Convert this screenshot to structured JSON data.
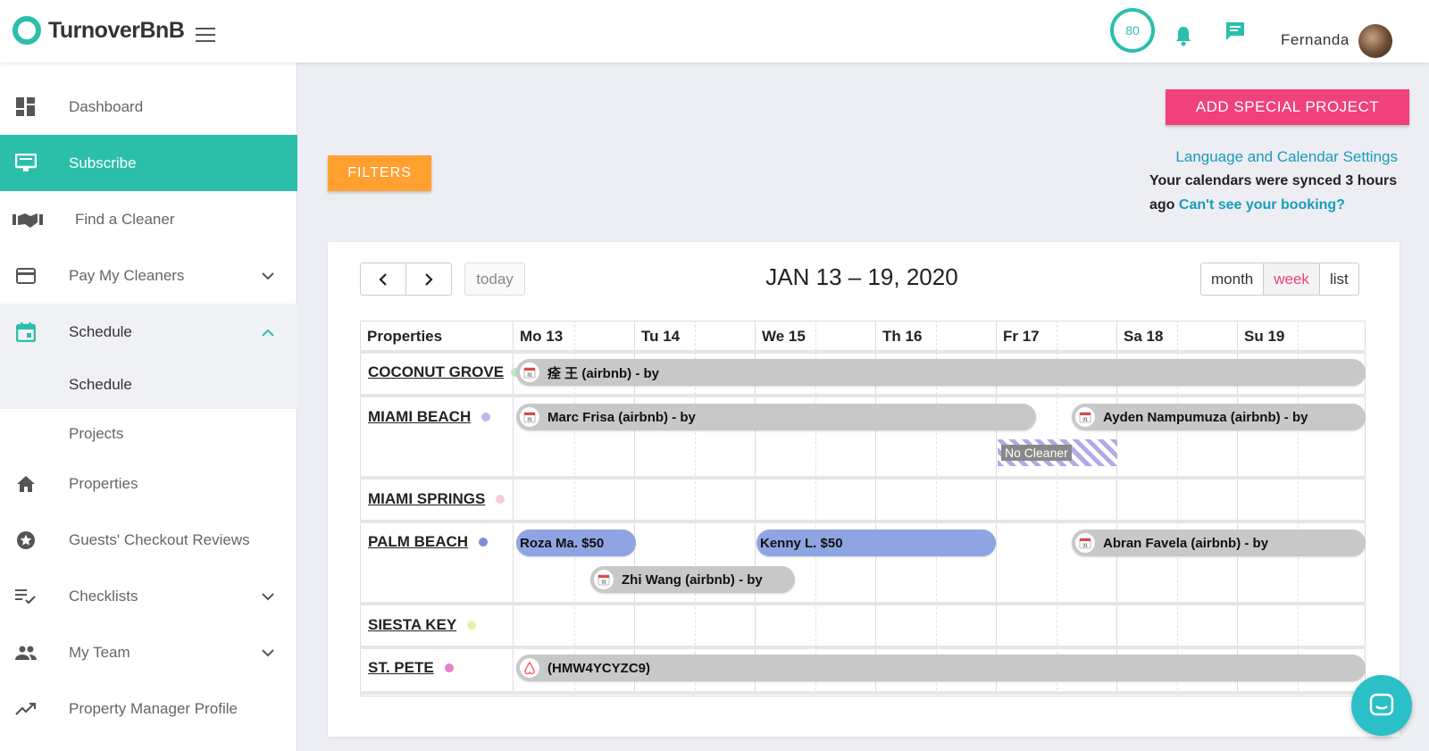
{
  "app": {
    "name": "TurnoverBnB"
  },
  "header": {
    "score": "80",
    "username": "Fernanda"
  },
  "sidebar": {
    "items": [
      {
        "label": "Dashboard",
        "icon": "dashboard-icon"
      },
      {
        "label": "Subscribe",
        "icon": "subscribe-icon"
      },
      {
        "label": "Find a Cleaner",
        "icon": "handshake-icon"
      },
      {
        "label": "Pay My Cleaners",
        "icon": "credit-card-icon"
      },
      {
        "label": "Schedule",
        "icon": "calendar-icon"
      },
      {
        "label": "Properties",
        "icon": "home-icon"
      },
      {
        "label": "Guests' Checkout Reviews",
        "icon": "star-icon"
      },
      {
        "label": "Checklists",
        "icon": "checklist-icon"
      },
      {
        "label": "My Team",
        "icon": "people-icon"
      },
      {
        "label": "Property Manager Profile",
        "icon": "trending-icon"
      }
    ],
    "schedule_sub": [
      "Schedule",
      "Projects"
    ]
  },
  "main": {
    "add_special_project": "ADD SPECIAL PROJECT",
    "filters": "FILTERS",
    "lang_settings": "Language and Calendar Settings",
    "sync_text": "Your calendars were synced 3 hours ago",
    "sync_link": "Can't see your booking?"
  },
  "calendar": {
    "today": "today",
    "range_title": "JAN 13 – 19, 2020",
    "views": [
      "month",
      "week",
      "list"
    ],
    "selected_view": "week",
    "properties_header": "Properties",
    "days": [
      "Mo 13",
      "Tu 14",
      "We 15",
      "Th 16",
      "Fr 17",
      "Sa 18",
      "Su 19"
    ],
    "properties": [
      {
        "name": "COCONUT GROVE",
        "color": "#b9e8c4"
      },
      {
        "name": "MIAMI BEACH",
        "color": "#c3b4f0"
      },
      {
        "name": "MIAMI SPRINGS",
        "color": "#f7c9e0"
      },
      {
        "name": "PALM BEACH",
        "color": "#7b8fd8"
      },
      {
        "name": "SIESTA KEY",
        "color": "#dff5a6"
      },
      {
        "name": "ST. PETE",
        "color": "#e780c7"
      }
    ],
    "events": [
      "痊 王 (airbnb) - by",
      "Marc Frisa (airbnb) - by",
      "Ayden Nampumuza (airbnb) - by",
      "No Cleaner",
      "Roza Ma. $50",
      "Kenny L. $50",
      "Abran Favela (airbnb) - by",
      "Zhi Wang (airbnb) - by",
      "(HMW4YCYZC9)"
    ]
  },
  "colors": {
    "teal": "#2bbfaa",
    "pink": "#f1417c",
    "orange": "#ffa031",
    "link": "#1a9bbb"
  }
}
